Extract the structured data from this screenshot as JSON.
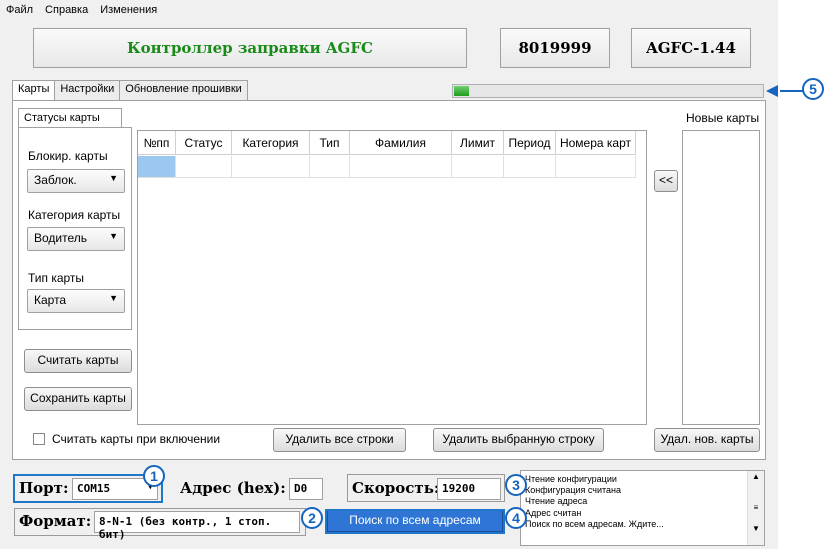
{
  "menu": [
    "Файл",
    "Справка",
    "Изменения"
  ],
  "header": {
    "title": "Контроллер заправки AGFC",
    "serial": "8019999",
    "version": "AGFC-1.44",
    "title_color": "#1a8a1a"
  },
  "tabs": [
    "Карты",
    "Настройки",
    "Обновление прошивки"
  ],
  "progress": {
    "value_percent": 5
  },
  "subtab": "Статусы карты",
  "filters": {
    "block_label": "Блокир. карты",
    "block_value": "Заблок.",
    "category_label": "Категория карты",
    "category_value": "Водитель",
    "type_label": "Тип карты",
    "type_value": "Карта"
  },
  "buttons": {
    "read_cards": "Считать карты",
    "save_cards": "Сохранить карты",
    "delete_all": "Удалить все строки",
    "delete_selected": "Удалить выбранную строку",
    "delete_new": "Удал. нов. карты",
    "move": "<<"
  },
  "table": {
    "columns": [
      "№пп",
      "Статус",
      "Категория",
      "Тип",
      "Фамилия",
      "Лимит",
      "Период",
      "Номера карт"
    ]
  },
  "new_cards_label": "Новые карты",
  "read_on_start": "Считать карты при включении",
  "connection": {
    "port_label": "Порт:",
    "port_value": "COM15",
    "address_label": "Адрес (hex):",
    "address_value": "D0",
    "speed_label": "Скорость:",
    "speed_value": "19200",
    "format_label": "Формат:",
    "format_value": "8-N-1 (без контр., 1 стоп. бит)",
    "search_button": "Поиск по всем адресам"
  },
  "log": [
    "Чтение конфигурации",
    "Конфигурация считана",
    "Чтение адреса",
    "Адрес считан",
    "Поиск по всем адресам. Ждите..."
  ],
  "callouts": [
    "1",
    "2",
    "3",
    "4",
    "5"
  ],
  "accent": "#1565c0"
}
